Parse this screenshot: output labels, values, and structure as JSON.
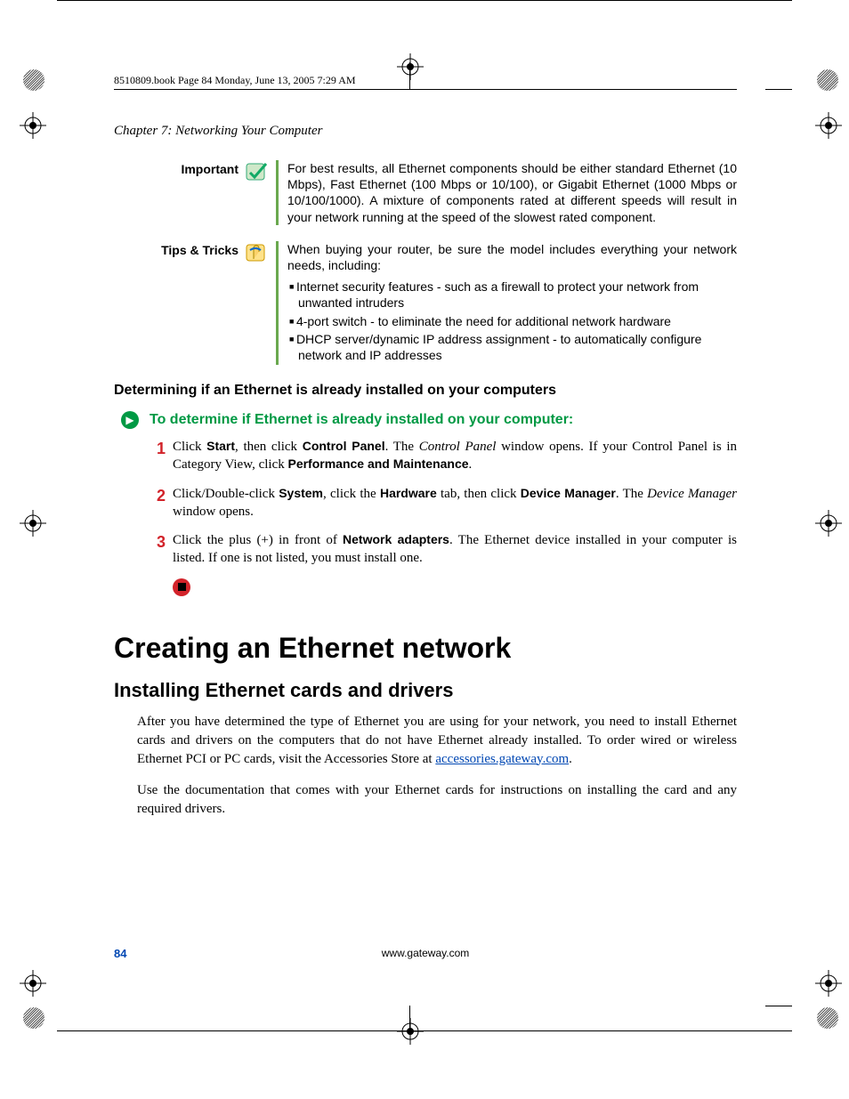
{
  "header": {
    "print_tag": "8510809.book  Page 84  Monday, June 13, 2005  7:29 AM"
  },
  "chapter": "Chapter 7: Networking Your Computer",
  "important": {
    "label": "Important",
    "text": "For best results, all Ethernet components should be either standard Ethernet (10 Mbps), Fast Ethernet (100 Mbps or 10/100), or Gigabit Ethernet (1000 Mbps or 10/100/1000). A mixture of components rated at different speeds will result in your network running at the speed of the slowest rated component."
  },
  "tips": {
    "label": "Tips & Tricks",
    "lead": "When buying your router, be sure the model includes everything your network needs, including:",
    "items": [
      "Internet security features - such as a firewall to protect your network from unwanted intruders",
      "4-port switch - to eliminate the need for additional network hardware",
      "DHCP server/dynamic IP address assignment - to automatically configure network and IP addresses"
    ]
  },
  "subheading": "Determining if an Ethernet is already installed on your computers",
  "task_title": "To determine if Ethernet is already installed on your computer:",
  "steps": {
    "s1": {
      "num": "1",
      "t1": "Click ",
      "b1": "Start",
      "t2": ", then click ",
      "b2": "Control Panel",
      "t3": ". The ",
      "i1": "Control Panel",
      "t4": " window opens. If your Control Panel is in Category View, click ",
      "b3": "Performance and Maintenance",
      "t5": "."
    },
    "s2": {
      "num": "2",
      "t1": "Click/Double-click ",
      "b1": "System",
      "t2": ", click the ",
      "b2": "Hardware",
      "t3": " tab, then click ",
      "b3": "Device Manager",
      "t4": ". The ",
      "i1": "Device Manager",
      "t5": " window opens."
    },
    "s3": {
      "num": "3",
      "t1": "Click the plus (+) in front of ",
      "b1": "Network adapters",
      "t2": ". The Ethernet device installed in your computer is listed. If one is not listed, you must install one."
    }
  },
  "h1": "Creating an Ethernet network",
  "h2": "Installing Ethernet cards and drivers",
  "p1a": "After you have determined the type of Ethernet you are using for your network, you need to install Ethernet cards and drivers on the computers that do not have Ethernet already installed. To order wired or wireless Ethernet PCI or PC cards, visit the Accessories Store at ",
  "p1link": "accessories.gateway.com",
  "p1b": ".",
  "p2": "Use the documentation that comes with your Ethernet cards for instructions on installing the card and any required drivers.",
  "footer": {
    "page": "84",
    "url": "www.gateway.com"
  }
}
